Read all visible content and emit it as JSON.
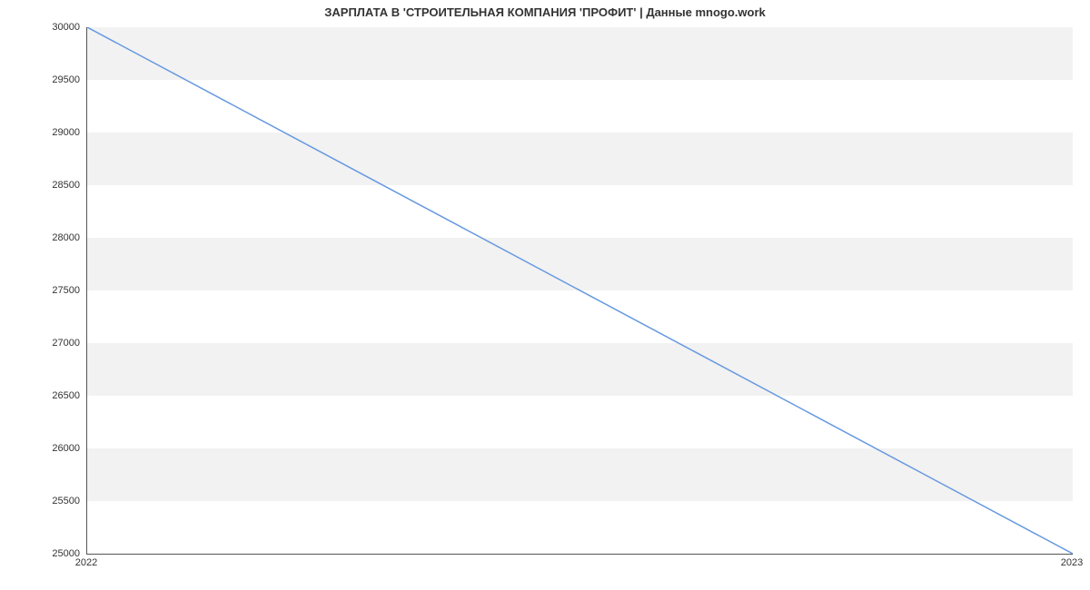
{
  "chart_data": {
    "type": "line",
    "title": "ЗАРПЛАТА В 'СТРОИТЕЛЬНАЯ КОМПАНИЯ 'ПРОФИТ' | Данные mnogo.work",
    "x": [
      "2022",
      "2023"
    ],
    "values": [
      30000,
      25000
    ],
    "ylim": [
      25000,
      30000
    ],
    "y_ticks": [
      25000,
      25500,
      26000,
      26500,
      27000,
      27500,
      28000,
      28500,
      29000,
      29500,
      30000
    ],
    "x_tick_labels": [
      "2022",
      "2023"
    ],
    "line_color": "#6699e0"
  }
}
